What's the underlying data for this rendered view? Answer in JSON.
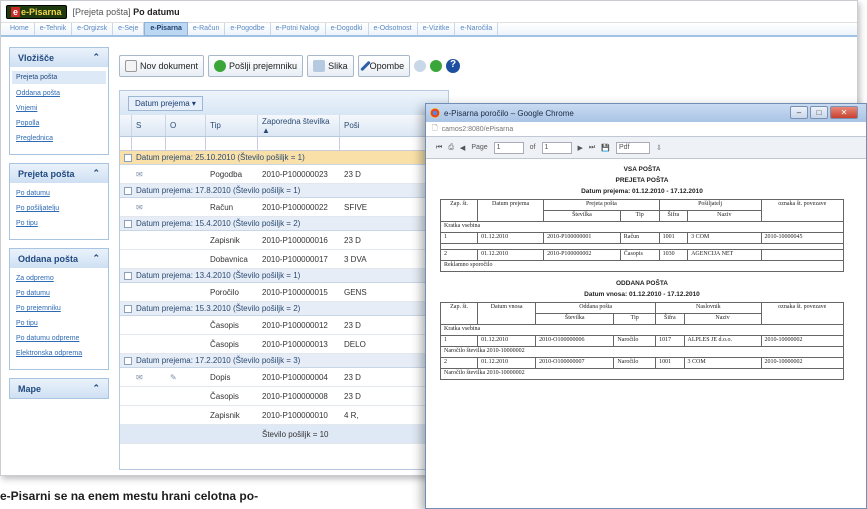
{
  "app": {
    "logo": "e-Pisarna",
    "breadcrumb_section": "[Prejeta pošta]",
    "breadcrumb_view": "Po datumu"
  },
  "menu": [
    "Home",
    "e-Tehnik",
    "e-Orgizsk",
    "e-Seje",
    "e-Pisarna",
    "e-Račun",
    "e-Pogodbe",
    "e-Potni Nalogi",
    "e-Dogodki",
    "e-Odsotnost",
    "e-Vizitke",
    "e-Naročila"
  ],
  "sidebar": {
    "vlozisce": {
      "title": "Vložišče",
      "items": [
        "Prejeta pošta",
        "Oddana pošta",
        "Vnjemi",
        "Popolla",
        "Preglednica"
      ]
    },
    "prejeta": {
      "title": "Prejeta pošta",
      "items": [
        "Po datumu",
        "Po pošiljatelju",
        "Po tipu"
      ]
    },
    "oddana": {
      "title": "Oddana pošta",
      "items": [
        "Za odpremo",
        "Po datumu",
        "Po prejemniku",
        "Po tipu",
        "Po datumu odpreme",
        "Elektronska odprema"
      ]
    },
    "mape": {
      "title": "Mape"
    }
  },
  "toolbar": {
    "new_doc": "Nov dokument",
    "send": "Pošlji prejemniku",
    "image": "Slika",
    "notes": "Opombe"
  },
  "grid": {
    "group_by": "Datum prejema",
    "columns": [
      "S",
      "O",
      "Tip",
      "Zaporedna številka ▲",
      "Poši"
    ],
    "groups": [
      {
        "label": "Datum prejema: 25.10.2010 (Število pošiljk = 1)",
        "rows": [
          [
            "✉",
            "",
            "Pogodba",
            "2010-P100000023",
            "23 D"
          ]
        ]
      },
      {
        "label": "Datum prejema: 17.8.2010 (Število pošiljk = 1)",
        "rows": [
          [
            "✉",
            "",
            "Račun",
            "2010-P100000022",
            "SFIVE"
          ]
        ]
      },
      {
        "label": "Datum prejema: 15.4.2010 (Število pošiljk = 2)",
        "rows": [
          [
            "",
            "",
            "Zapisnik",
            "2010-P100000016",
            "23 D"
          ],
          [
            "",
            "",
            "Dobavnica",
            "2010-P100000017",
            "3 DVA"
          ]
        ]
      },
      {
        "label": "Datum prejema: 13.4.2010 (Število pošiljk = 1)",
        "rows": [
          [
            "",
            "",
            "Poročilo",
            "2010-P100000015",
            "GENS"
          ]
        ]
      },
      {
        "label": "Datum prejema: 15.3.2010 (Število pošiljk = 2)",
        "rows": [
          [
            "",
            "",
            "Časopis",
            "2010-P100000012",
            "23 D"
          ],
          [
            "",
            "",
            "Časopis",
            "2010-P100000013",
            "DELO"
          ]
        ]
      },
      {
        "label": "Datum prejema: 17.2.2010 (Število pošiljk = 3)",
        "rows": [
          [
            "✉",
            "✎",
            "Dopis",
            "2010-P100000004",
            "23 D"
          ],
          [
            "",
            "",
            "Časopis",
            "2010-P100000008",
            "23 D"
          ],
          [
            "",
            "",
            "Zapisnik",
            "2010-P100000010",
            "4 R,"
          ]
        ]
      }
    ],
    "summary": "Število pošiljk = 10"
  },
  "report": {
    "window_title": "e-Pisarna poročilo – Google Chrome",
    "address": "camos2:8080/ePisarna",
    "page_label": "Page",
    "page": "1",
    "of_label": "of",
    "pages": "1",
    "format": "Pdf",
    "h_all": "VSA POŠTA",
    "h_in": "PREJETA POŠTA",
    "in_range": "Datum prejema: 01.12.2010 - 17.12.2010",
    "in_cols": {
      "zap": "Zap. št.",
      "datum": "Datum prejema",
      "group": "Prejeta pošta",
      "stevilka": "Številka",
      "tip": "Tip",
      "sender_group": "Pošiljatelj",
      "sifra": "Šifra",
      "naziv": "Naziv",
      "oznaka": "oznaka št. povezave"
    },
    "in_sec1": "Kratka vsebina",
    "in_row1": [
      "1",
      "01.12.2010",
      "2010-P100000001",
      "Račun",
      "1001",
      "3 COM",
      "2010-10000045"
    ],
    "in_row2": [
      "2",
      "01.12.2010",
      "2010-P100000002",
      "Časopis",
      "1030",
      "AGENCIJA NET",
      ""
    ],
    "in_sec2": "Reklamno sporočilo",
    "h_out": "ODDANA POŠTA",
    "out_range": "Datum vnosa: 01.12.2010 - 17.12.2010",
    "out_cols": {
      "zap": "Zap. št.",
      "datum": "Datum vnosa",
      "group": "Oddana pošta",
      "stevilka": "Številka",
      "tip": "Tip",
      "recv_group": "Naslovnik",
      "sifra": "Šifra",
      "naziv": "Naziv",
      "oznaka": "oznaka št. povezave"
    },
    "out_sec1": "Kratka vsebina",
    "out_row1": [
      "1",
      "01.12.2010",
      "2010-O100000006",
      "Naročilo",
      "1017",
      "ALPLES JE d.o.o.",
      "2010-10000002"
    ],
    "out_note1": "Naročilo številka 2010-10000002",
    "out_row2": [
      "2",
      "01.12.2010",
      "2010-O100000007",
      "Naročilo",
      "1001",
      "3 COM",
      "2010-10000002"
    ],
    "out_note2": "Naročilo številka 2010-10000002"
  },
  "caption": "e-Pisarni se na enem mestu hrani celotna po-"
}
